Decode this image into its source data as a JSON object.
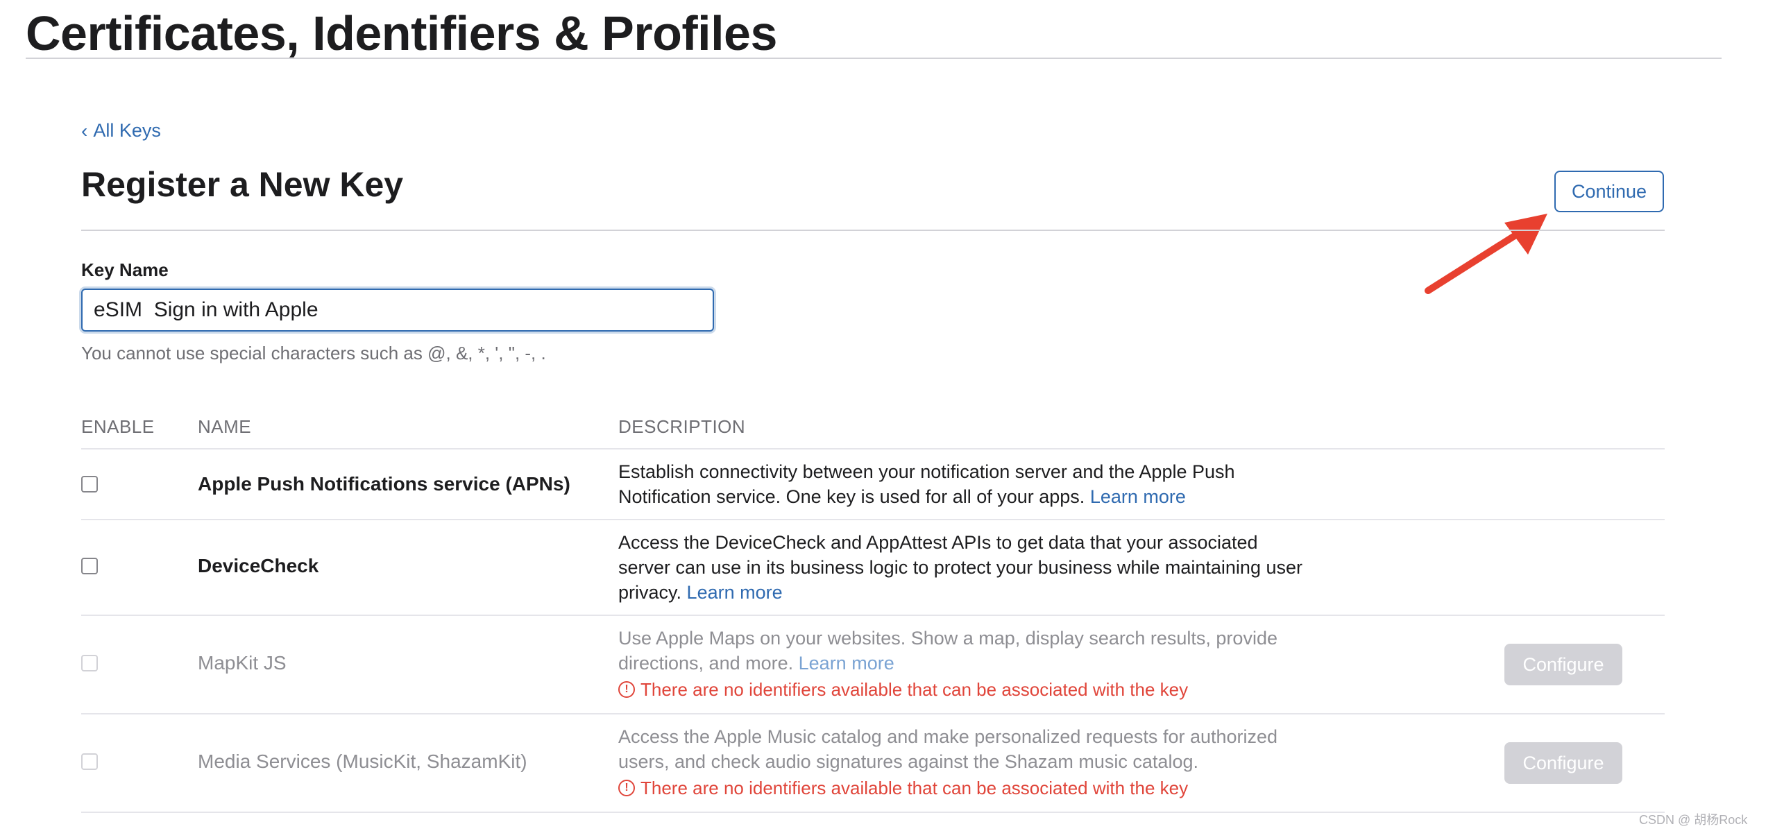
{
  "header": {
    "site_title": "Certificates, Identifiers & Profiles"
  },
  "nav": {
    "back_label": "All Keys"
  },
  "page": {
    "heading": "Register a New Key",
    "continue_label": "Continue"
  },
  "form": {
    "key_name_label": "Key Name",
    "key_name_value": "eSIM  Sign in with Apple",
    "key_name_hint": "You cannot use special characters such as @, &, *, ', \", -, ."
  },
  "table": {
    "columns": [
      "ENABLE",
      "NAME",
      "DESCRIPTION"
    ],
    "rows": [
      {
        "name": "Apple Push Notifications service (APNs)",
        "desc_line1": "Establish connectivity between your notification server and the Apple Push",
        "desc_line2": "Notification service. One key is used for all of your apps.",
        "learn_more": "Learn more",
        "enabled": true,
        "checked": false
      },
      {
        "name": "DeviceCheck",
        "desc_line1": "Access the DeviceCheck and AppAttest APIs to get data that your associated",
        "desc_line2": "server can use in its business logic to protect your business while maintaining user",
        "desc_line3": "privacy.",
        "learn_more": "Learn more",
        "enabled": true,
        "checked": false
      },
      {
        "name": "MapKit JS",
        "desc_line1": "Use Apple Maps on your websites. Show a map, display search results, provide",
        "desc_line2": "directions, and more.",
        "learn_more": "Learn more",
        "warning": "There are no identifiers available that can be associated with the key",
        "configure_label": "Configure",
        "enabled": false,
        "checked": false
      },
      {
        "name": "Media Services (MusicKit, ShazamKit)",
        "desc_line1": "Access the Apple Music catalog and make personalized requests for authorized",
        "desc_line2": "users, and check audio signatures against the Shazam music catalog.",
        "warning": "There are no identifiers available that can be associated with the key",
        "configure_label": "Configure",
        "enabled": false,
        "checked": false
      }
    ]
  },
  "watermark": "CSDN @ 胡杨Rock",
  "colors": {
    "link": "#2f6ab0",
    "warning": "#e0453a",
    "annotation_arrow": "#e8402f"
  }
}
